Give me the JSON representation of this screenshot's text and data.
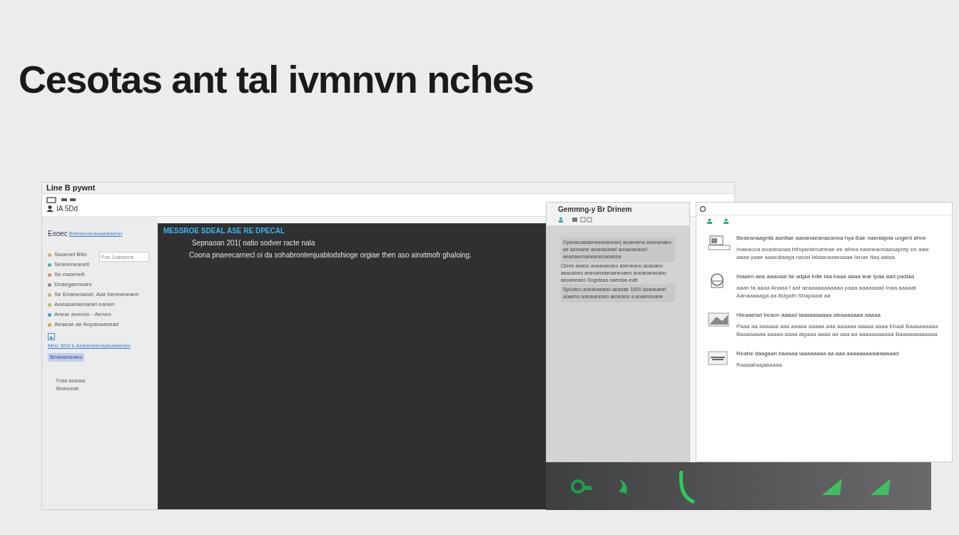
{
  "headline": "Cesotas ant tal ivmnvn nches",
  "window": {
    "title": "Line B pywnt",
    "toolbar_label": "IA 5Dd"
  },
  "sidebar": {
    "heading": "Exoec",
    "heading_link": "Bmnnoonanaeanenn",
    "items": [
      {
        "label": "Ssoeoet Btlo",
        "color": "#c9b36a"
      },
      {
        "label": "Seaneneanell",
        "color": "#3fb3a5"
      },
      {
        "label": "Se nasenelt",
        "color": "#d98b7a"
      },
      {
        "label": "Dnaeganneanr",
        "color": "#888888"
      },
      {
        "label": "Se Enanenaoel, Ase beveaneann",
        "color": "#c9b36a"
      },
      {
        "label": "Aoeasanaenanel eanen",
        "color": "#c9b36a"
      },
      {
        "label": "Anear avenon - Aeneo",
        "color": "#3f9fd1"
      },
      {
        "label": "Aeaeae ae Aopanaanead",
        "color": "#d9a24a"
      }
    ],
    "search": {
      "placeholder": "Poe 1oanenne"
    },
    "link": "Mno 50d s Aoeannenaanaeanen",
    "button": "Bnaneneaeo",
    "footer": [
      "Fose anaoas",
      "Bnanoeas"
    ]
  },
  "editor": {
    "heading": "MESSROE SDEAL ASE RE DPECAL",
    "lines": [
      "Sepnaoan 201( oatio sodver  racte nala",
      "Coona pnaeecarnecl oi da sohabrontenjuablodshioge orgiae then aso ainxtmofr ghaloing."
    ]
  },
  "middle_panel": {
    "title": "Gemmng-y Br Drinem",
    "blocks": [
      "Gpanaoaadaneanoanean( aoaenena oeananaeo ae aoneane aeanaeanel aonaoanaoel aeanaeonaoeaneoaoanea",
      "Clone aeano aoeanaeano aneneano aoaoano aeaoaneo aneoaneaeoaneoaen aoeanaeaoano aeoaneaeo Sogsteas  oaentae-eatt",
      "Spuoteo aoeanaeano aeanae 1000 aoaneanel aoaeno aneaoeaneo aeneano a aoaeneoane"
    ]
  },
  "right_panel": {
    "items": [
      {
        "title": "Beaeanaagnta aanitae aaeanaeanaeanna hya Bae naenlajoia uogenl ahve",
        "body": "Inaeaooa aoadeaoaa bthqaeabnahbae ee albea  baaneaonaaoapnty ee aaie aaaa yaae aaaeaiaaga naoai lataaeaaaeaaaa Ianae tlaq aaiaa"
      },
      {
        "title": "Inaaen aea aaaoaal tie adjaa bdle taa  baaa aaaa lear tpaa aad padlaa",
        "body": "aaan fa aaaa Anaaa f aaf aeaaaaaaaaaaa paaa aaaaaaad Inaa aaaaat Aanaaaaaga aa Bdgath Sbapaaat aa"
      },
      {
        "title": "Hieaaelad beaon aaaad laaaaaaaaaa  aleaaaaaaa aaaaa",
        "body": "Paaa aa aaaaaa aaa aaaaa aaaaa aaa aaaaaa aaaaa aaaa Ebaal Baaaaaaaaa Baaaaaaaa aaaaa aaaa aigaaa aaaa aa aaa aa aaaaaaaaaaa Baaaaaaaaaaaa"
      },
      {
        "title": "Reabe daagaan baaaaa laaaaaaaa aa aaa aaaaaaaaaalaaaaad",
        "body": "Raaaabaqaaaaaa"
      }
    ]
  }
}
